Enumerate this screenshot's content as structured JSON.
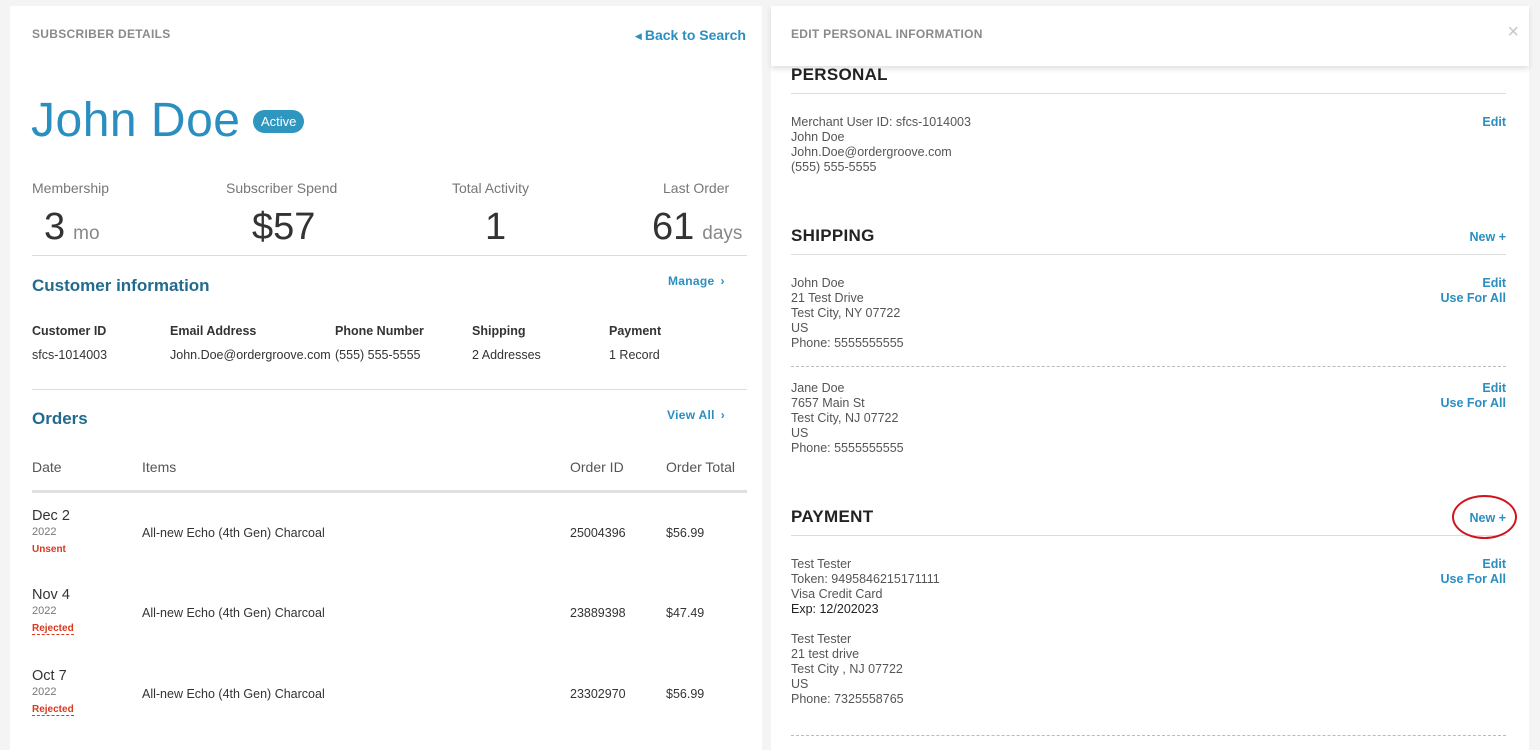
{
  "left": {
    "header": "SUBSCRIBER DETAILS",
    "back_label": "Back to Search",
    "name": "John Doe",
    "status": "Active",
    "stats": [
      {
        "label": "Membership",
        "value": "3",
        "unit": "mo"
      },
      {
        "label": "Subscriber Spend",
        "value": "$57",
        "unit": ""
      },
      {
        "label": "Total Activity",
        "value": "1",
        "unit": ""
      },
      {
        "label": "Last Order",
        "value": "61",
        "unit": "days"
      }
    ],
    "customer_info": {
      "title": "Customer information",
      "manage_label": "Manage",
      "headers": [
        "Customer ID",
        "Email Address",
        "Phone Number",
        "Shipping",
        "Payment"
      ],
      "values": [
        "sfcs-1014003",
        "John.Doe@ordergroove.com",
        "(555) 555-5555",
        "2 Addresses",
        "1 Record"
      ]
    },
    "orders": {
      "title": "Orders",
      "view_all_label": "View All",
      "headers": [
        "Date",
        "Items",
        "Order ID",
        "Order Total"
      ],
      "rows": [
        {
          "date": "Dec 2",
          "year": "2022",
          "status": "Unsent",
          "item": "All-new Echo (4th Gen) Charcoal",
          "order_id": "25004396",
          "total": "$56.99"
        },
        {
          "date": "Nov 4",
          "year": "2022",
          "status": "Rejected",
          "item": "All-new Echo (4th Gen) Charcoal",
          "order_id": "23889398",
          "total": "$47.49"
        },
        {
          "date": "Oct 7",
          "year": "2022",
          "status": "Rejected",
          "item": "All-new Echo (4th Gen) Charcoal",
          "order_id": "23302970",
          "total": "$56.99"
        }
      ]
    }
  },
  "right": {
    "header": "EDIT PERSONAL INFORMATION",
    "close_glyph": "×",
    "personal": {
      "title": "PERSONAL",
      "edit_label": "Edit",
      "lines": [
        "Merchant User ID: sfcs-1014003",
        "John Doe",
        "John.Doe@ordergroove.com",
        "(555) 555-5555"
      ]
    },
    "shipping": {
      "title": "SHIPPING",
      "new_label": "New +",
      "edit_label": "Edit",
      "use_label": "Use For All",
      "addresses": [
        {
          "lines": [
            "John Doe",
            "21 Test Drive",
            "Test City, NY 07722",
            "US",
            "Phone: 5555555555"
          ]
        },
        {
          "lines": [
            "Jane Doe",
            "7657 Main St",
            "Test City, NJ 07722",
            "US",
            "Phone: 5555555555"
          ]
        }
      ]
    },
    "payment": {
      "title": "PAYMENT",
      "new_label": "New +",
      "edit_label": "Edit",
      "use_label": "Use For All",
      "card_lines": [
        "Test Tester",
        "Token: 9495846215171111",
        "Visa Credit Card"
      ],
      "exp": "Exp: 12/202023",
      "billing_lines": [
        "Test Tester",
        "21 test drive",
        "Test City , NJ 07722",
        "US",
        "Phone: 7325558765"
      ]
    }
  },
  "colors": {
    "accent": "#2a8fc0",
    "section_title": "#236a8f",
    "status_red": "#d9381e",
    "annotation_circle": "#d0141c"
  }
}
